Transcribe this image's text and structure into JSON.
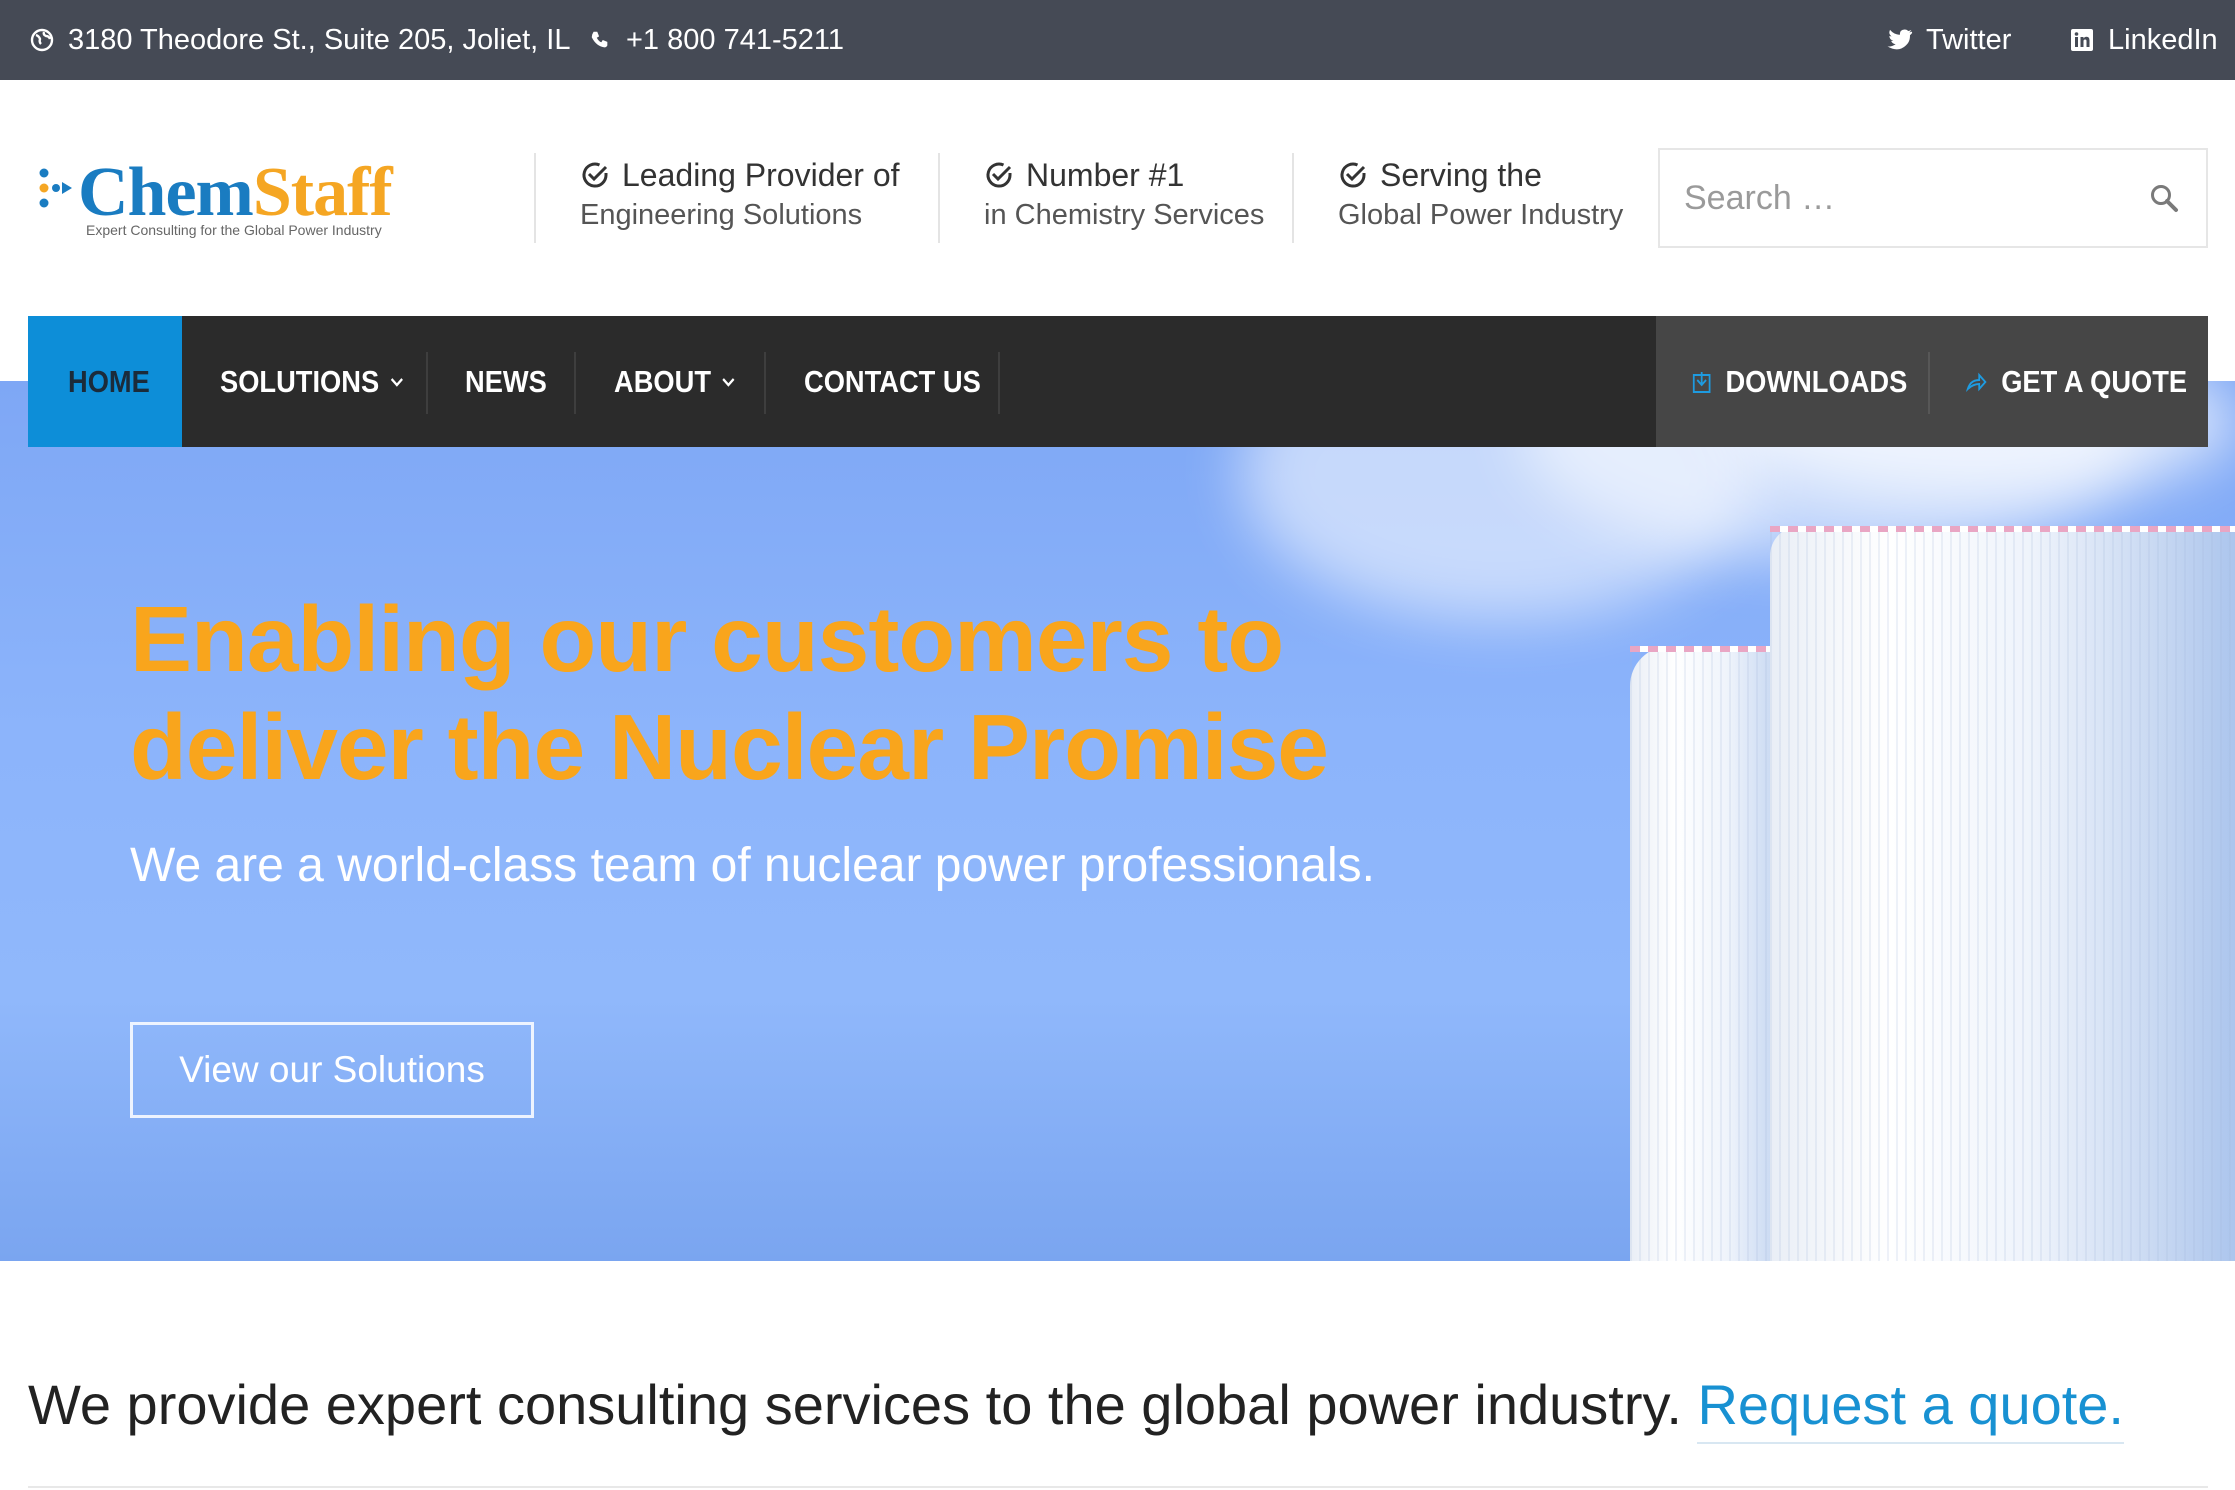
{
  "topbar": {
    "address": "3180 Theodore St., Suite 205, Joliet, IL",
    "phone": "+1 800 741-5211",
    "social": [
      {
        "label": "Twitter",
        "icon": "twitter-icon"
      },
      {
        "label": "LinkedIn",
        "icon": "linkedin-icon"
      }
    ]
  },
  "logo": {
    "name_part1": "Chem",
    "name_part2": "Staff",
    "tagline": "Expert Consulting for the Global Power Industry"
  },
  "highlights": [
    {
      "title": "Leading Provider of",
      "subtitle": "Engineering Solutions",
      "icon": "check-circle-icon"
    },
    {
      "title": "Number #1",
      "subtitle": "in Chemistry Services",
      "icon": "check-circle-icon"
    },
    {
      "title": "Serving the",
      "subtitle": "Global Power Industry",
      "icon": "check-circle-icon"
    }
  ],
  "search": {
    "placeholder": "Search …",
    "value": "",
    "icon": "search-icon"
  },
  "nav": {
    "items": [
      {
        "label": "HOME",
        "active": true,
        "dropdown": false
      },
      {
        "label": "SOLUTIONS",
        "active": false,
        "dropdown": true
      },
      {
        "label": "NEWS",
        "active": false,
        "dropdown": false
      },
      {
        "label": "ABOUT",
        "active": false,
        "dropdown": true
      },
      {
        "label": "CONTACT US",
        "active": false,
        "dropdown": false
      }
    ],
    "actions": [
      {
        "label": "DOWNLOADS",
        "icon": "download-icon"
      },
      {
        "label": "GET A QUOTE",
        "icon": "share-arrow-icon"
      }
    ]
  },
  "hero": {
    "title": "Enabling our customers to deliver the Nuclear Promise",
    "subtitle": "We are a world-class team of nuclear power professionals.",
    "button": "View our Solutions"
  },
  "intro": {
    "text": "We provide expert consulting services to the global power industry.",
    "link": "Request a quote."
  },
  "colors": {
    "topbar": "#454a55",
    "nav": "#2b2b2b",
    "nav_active": "#0d8ed8",
    "hero_title": "#f9a51c",
    "hero_bg": "#8cb4fb",
    "link": "#1891d2"
  }
}
